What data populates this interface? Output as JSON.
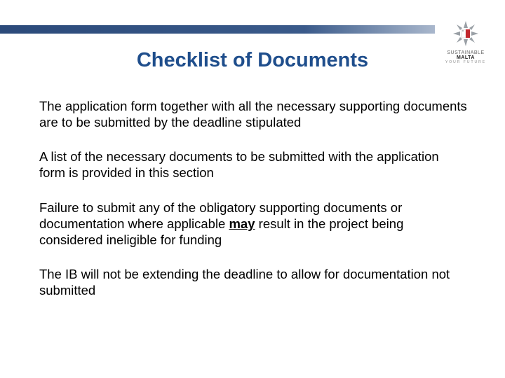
{
  "slide": {
    "title": "Checklist of Documents"
  },
  "brand": {
    "line1_light": "SUSTAINABLE",
    "line1_bold": "MALTA",
    "sub": "YOUR FUTURE"
  },
  "paragraphs": {
    "p1": "The application form together with all the necessary supporting documents are to be submitted by the deadline stipulated",
    "p2": "A list of the necessary documents to be submitted with the application form is provided in this section",
    "p3a": "Failure to submit any of the obligatory supporting documents or documentation where applicable ",
    "p3u": "may",
    "p3b": " result in the project being considered ineligible for funding",
    "p4": "The IB will not be extending the deadline to allow for documentation not submitted"
  }
}
